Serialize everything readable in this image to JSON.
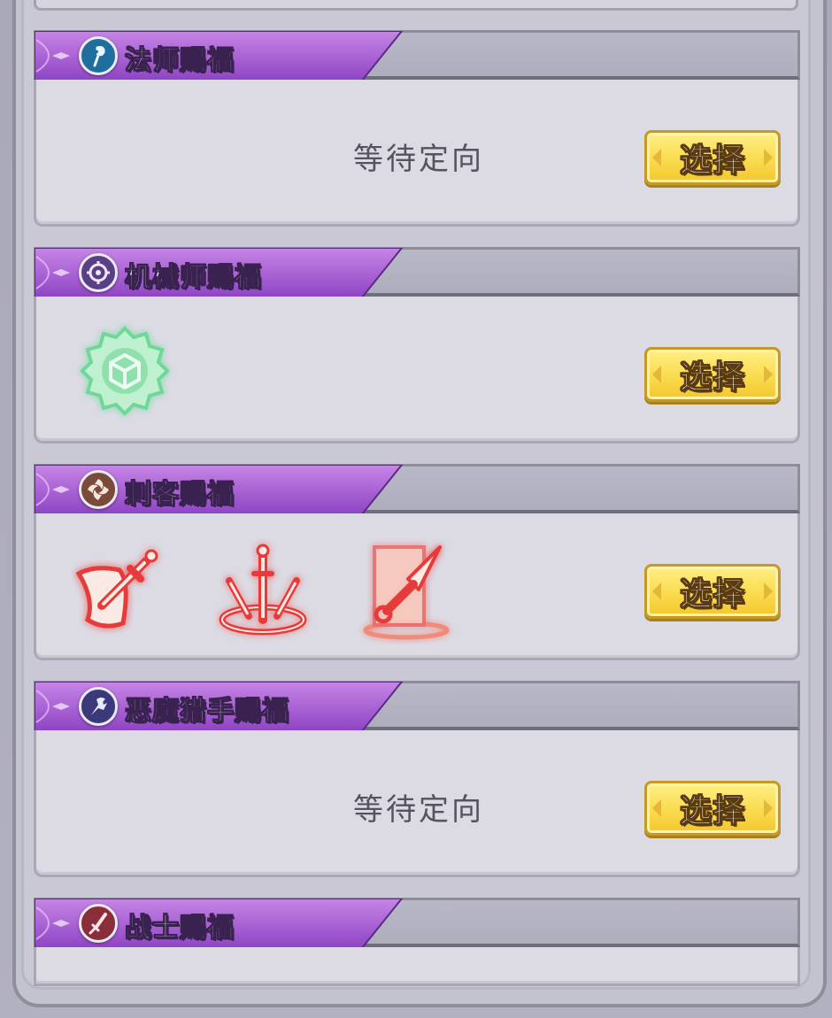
{
  "sections": [
    {
      "title": "法师赐福",
      "icon": "mage-staff-icon",
      "icon_color": "#1f6f9e",
      "status": "等待定向",
      "button": "选择"
    },
    {
      "title": "机械师赐福",
      "icon": "gear-icon",
      "icon_color": "#5b3f86",
      "button": "选择",
      "blessings": [
        {
          "icon": "green-gear-cube-icon",
          "color": "#6fd79a"
        }
      ]
    },
    {
      "title": "刺客赐福",
      "icon": "shuriken-icon",
      "icon_color": "#7a4a3a",
      "button": "选择",
      "blessings": [
        {
          "icon": "scroll-dagger-icon",
          "color": "#e63a3a"
        },
        {
          "icon": "triple-swords-icon",
          "color": "#e63a3a"
        },
        {
          "icon": "kunai-door-icon",
          "color": "#e86a6a"
        }
      ]
    },
    {
      "title": "恶魔猎手赐福",
      "icon": "demon-hunter-icon",
      "icon_color": "#3a3a7a",
      "status": "等待定向",
      "button": "选择"
    },
    {
      "title": "战士赐福",
      "icon": "sword-icon",
      "icon_color": "#8a2e3a"
    }
  ]
}
